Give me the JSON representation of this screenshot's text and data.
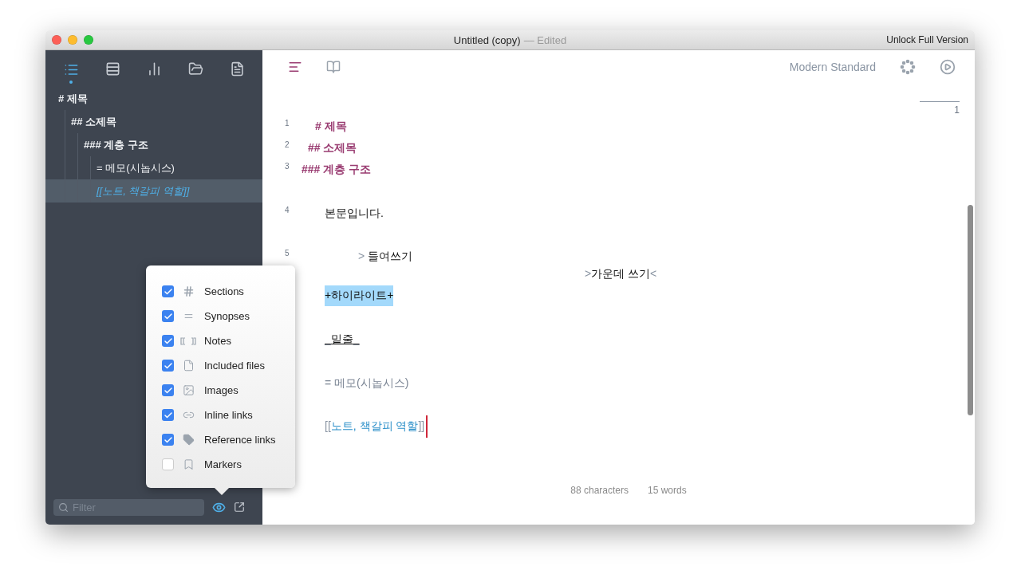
{
  "window": {
    "title": "Untitled (copy)",
    "status": "— Edited",
    "action": "Unlock Full Version"
  },
  "sidebar": {
    "tabs": [
      {
        "kind": "outline",
        "selected": true
      },
      {
        "kind": "cards",
        "selected": false
      },
      {
        "kind": "stats",
        "selected": false
      },
      {
        "kind": "files",
        "selected": false
      },
      {
        "kind": "document",
        "selected": false
      }
    ],
    "outline": [
      {
        "label": "# 제목",
        "kind": "heading",
        "selected": false,
        "children": [
          {
            "label": "## 소제목",
            "kind": "heading",
            "selected": false,
            "children": [
              {
                "label": "### 계층 구조",
                "kind": "heading",
                "selected": false,
                "children": [
                  {
                    "label": "= 메모(시놉시스)",
                    "kind": "synopsis",
                    "selected": false
                  },
                  {
                    "label": "[[노트, 책갈피 역할]]",
                    "kind": "note",
                    "selected": true
                  }
                ]
              }
            ]
          }
        ]
      }
    ],
    "filter": {
      "placeholder": "Filter"
    },
    "filter_menu": [
      {
        "kind": "sections",
        "label": "Sections",
        "checked": true
      },
      {
        "kind": "synopses",
        "label": "Synopses",
        "checked": true
      },
      {
        "kind": "notes",
        "label": "Notes",
        "checked": true
      },
      {
        "kind": "files",
        "label": "Included files",
        "checked": true
      },
      {
        "kind": "images",
        "label": "Images",
        "checked": true
      },
      {
        "kind": "inline_links",
        "label": "Inline links",
        "checked": true
      },
      {
        "kind": "reference_links",
        "label": "Reference links",
        "checked": true
      },
      {
        "kind": "markers",
        "label": "Markers",
        "checked": false
      }
    ]
  },
  "editor": {
    "theme": "Modern Standard",
    "page_number": "1",
    "lines": [
      {
        "kind": "h1",
        "number": "1",
        "text": "# 제목"
      },
      {
        "kind": "h2",
        "number": "2",
        "text": "## 소제목"
      },
      {
        "kind": "h3",
        "number": "3",
        "text": "### 계층 구조"
      },
      {
        "kind": "body",
        "number": "4",
        "text": "본문입니다."
      },
      {
        "kind": "indent",
        "number": "5",
        "marker": ">",
        "text": "들여쓰기"
      },
      {
        "kind": "center",
        "marker": ">",
        "text": "가운데 쓰기",
        "end_marker": "<"
      },
      {
        "kind": "highlight",
        "text": "+하이라이트+"
      },
      {
        "kind": "underline",
        "marker": "_",
        "text": "밑줄",
        "end_marker": "_"
      },
      {
        "kind": "synopsis",
        "text": "= 메모(시놉시스)"
      },
      {
        "kind": "note",
        "marker": "[[",
        "text": "노트, 책갈피 역할",
        "end_marker": "]]"
      }
    ],
    "status": {
      "characters": "88 characters",
      "words": "15 words"
    }
  }
}
